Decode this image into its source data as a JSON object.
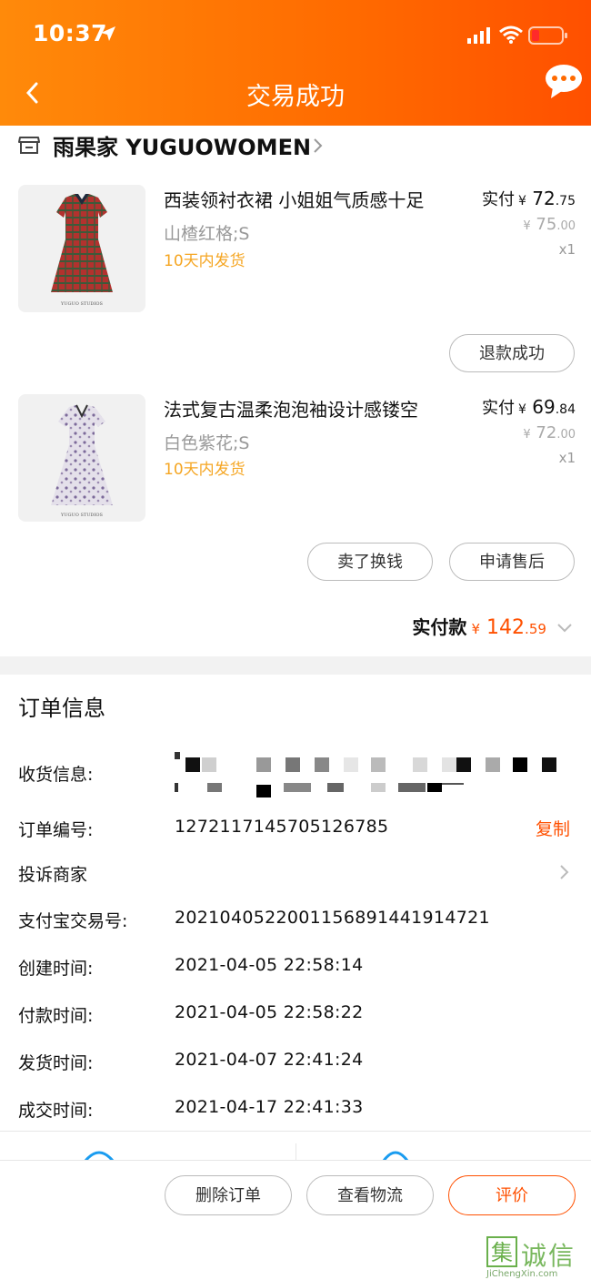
{
  "status_bar": {
    "time": "10:37"
  },
  "header": {
    "title": "交易成功"
  },
  "shop": {
    "name": "雨果家 YUGUOWOMEN"
  },
  "items": [
    {
      "title": "西装领衬衣裙 小姐姐气质感十足",
      "spec": "山楂红格;S",
      "shipping": "10天内发货",
      "paid_label": "实付",
      "currency": "¥",
      "paid_int": "72",
      "paid_dec": ".75",
      "orig_int": "75",
      "orig_dec": ".00",
      "qty": "x1",
      "image_brand": "YUGUO STUDIOS",
      "actions": [
        "退款成功"
      ]
    },
    {
      "title": "法式复古温柔泡泡袖设计感镂空",
      "spec": "白色紫花;S",
      "shipping": "10天内发货",
      "paid_label": "实付",
      "currency": "¥",
      "paid_int": "69",
      "paid_dec": ".84",
      "orig_int": "72",
      "orig_dec": ".00",
      "qty": "x1",
      "image_brand": "YUGUO STUDIOS",
      "actions": [
        "卖了换钱",
        "申请售后"
      ]
    }
  ],
  "total": {
    "label": "实付款",
    "currency": "¥",
    "int": "142",
    "dec": ".59"
  },
  "order_info": {
    "title": "订单信息",
    "rows": [
      {
        "label": "收货信息:",
        "value": ""
      },
      {
        "label": "订单编号:",
        "value": "1272117145705126785",
        "action": "复制"
      },
      {
        "label": "投诉商家",
        "value": ""
      },
      {
        "label": "支付宝交易号:",
        "value": "2021040522001156891441914721"
      },
      {
        "label": "创建时间:",
        "value": "2021-04-05 22:58:14"
      },
      {
        "label": "付款时间:",
        "value": "2021-04-05 22:58:22"
      },
      {
        "label": "发货时间:",
        "value": "2021-04-07 22:41:24"
      },
      {
        "label": "成交时间:",
        "value": "2021-04-17 22:41:33"
      }
    ]
  },
  "bottom_actions": [
    "删除订单",
    "查看物流",
    "评价"
  ],
  "watermark": {
    "text": "集诚信",
    "url": "JiChengXin.com"
  },
  "colors": {
    "accent": "#ff5000",
    "header_start": "#ff8a0a",
    "ship": "#f5a623"
  }
}
